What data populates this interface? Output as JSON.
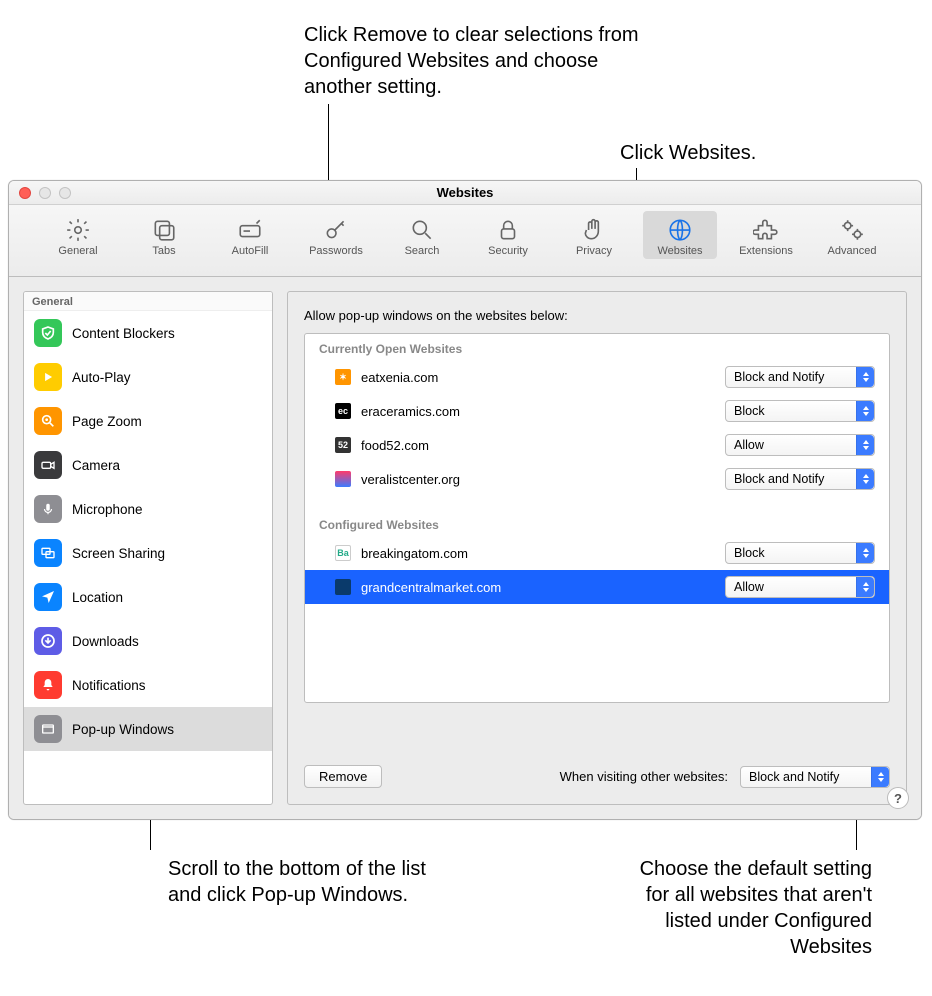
{
  "window_title": "Websites",
  "callouts": {
    "top_left": "Click Remove to clear selections from Configured Websites and choose another setting.",
    "top_right": "Click Websites.",
    "bottom_left": "Scroll to the bottom of the list and click Pop-up Windows.",
    "bottom_right": "Choose the default setting for all websites that aren't listed under Configured Websites"
  },
  "toolbar": [
    {
      "label": "General"
    },
    {
      "label": "Tabs"
    },
    {
      "label": "AutoFill"
    },
    {
      "label": "Passwords"
    },
    {
      "label": "Search"
    },
    {
      "label": "Security"
    },
    {
      "label": "Privacy"
    },
    {
      "label": "Websites"
    },
    {
      "label": "Extensions"
    },
    {
      "label": "Advanced"
    }
  ],
  "sidebar_header": "General",
  "sidebar": [
    {
      "label": "Content Blockers",
      "color": "#34c759"
    },
    {
      "label": "Auto-Play",
      "color": "#ffcc00"
    },
    {
      "label": "Page Zoom",
      "color": "#ff9500"
    },
    {
      "label": "Camera",
      "color": "#3a3a3c"
    },
    {
      "label": "Microphone",
      "color": "#8e8e93"
    },
    {
      "label": "Screen Sharing",
      "color": "#0a84ff"
    },
    {
      "label": "Location",
      "color": "#0a84ff"
    },
    {
      "label": "Downloads",
      "color": "#5e5ce6"
    },
    {
      "label": "Notifications",
      "color": "#ff3b30"
    },
    {
      "label": "Pop-up Windows",
      "color": "#8e8e93"
    }
  ],
  "main_title": "Allow pop-up windows on the websites below:",
  "section_open": "Currently Open Websites",
  "section_configured": "Configured Websites",
  "open_sites": [
    {
      "domain": "eatxenia.com",
      "setting": "Block and Notify",
      "favcolor": "#ff9500"
    },
    {
      "domain": "eraceramics.com",
      "setting": "Block",
      "favcolor": "#000"
    },
    {
      "domain": "food52.com",
      "setting": "Allow",
      "favcolor": "#333",
      "favtext": "52"
    },
    {
      "domain": "veralistcenter.org",
      "setting": "Block and Notify",
      "favgrad": true
    }
  ],
  "configured_sites": [
    {
      "domain": "breakingatom.com",
      "setting": "Block",
      "favcolor": "#fff",
      "favtext": "Ba",
      "favborder": true
    },
    {
      "domain": "grandcentralmarket.com",
      "setting": "Allow",
      "favcolor": "#0a3a6b",
      "selected": true
    }
  ],
  "remove_label": "Remove",
  "other_label": "When visiting other websites:",
  "other_value": "Block and Notify",
  "help_label": "?"
}
